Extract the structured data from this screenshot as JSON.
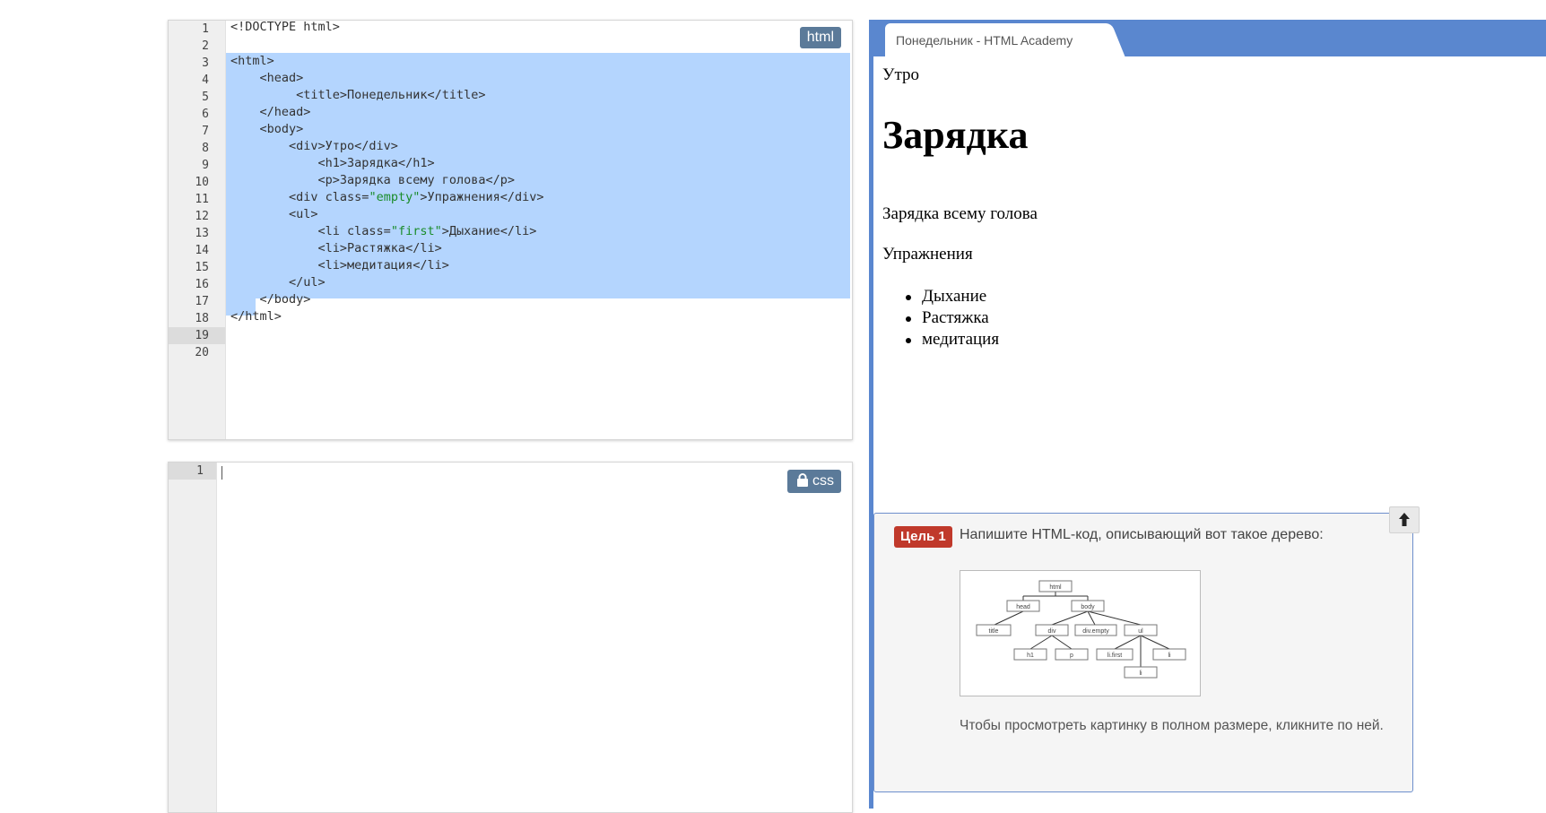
{
  "html_editor": {
    "badge": "html",
    "line_numbers": [
      "1",
      "2",
      "3",
      "4",
      "5",
      "6",
      "7",
      "8",
      "9",
      "10",
      "11",
      "12",
      "13",
      "14",
      "15",
      "16",
      "17",
      "18",
      "19",
      "20"
    ],
    "lines": [
      "<!DOCTYPE html>",
      "",
      "<html>",
      "    <head>",
      "         <title>Понедельник</title>",
      "    </head>",
      "    <body>",
      "        <div>Утро</div>",
      "            <h1>Зарядка</h1>",
      "            <p>Зарядка всему голова</p>",
      "        <div class=\"empty\">Упражнения</div>",
      "        <ul>",
      "            <li class=\"first\">Дыхание</li>",
      "            <li>Растяжка</li>",
      "            <li>медитация</li>",
      "        </ul>",
      "    </body>",
      "</html>",
      "",
      ""
    ],
    "line11": {
      "a": "        <div class=",
      "s": "\"empty\"",
      "b": ">Упражнения</div>"
    },
    "line13": {
      "a": "            <li class=",
      "s": "\"first\"",
      "b": ">Дыхание</li>"
    }
  },
  "css_editor": {
    "badge": "css",
    "badge_icon": "lock-icon",
    "line_numbers": [
      "1"
    ]
  },
  "preview": {
    "tab_title": "Понедельник - HTML Academy",
    "div_text": "Утро",
    "h1_text": "Зарядка",
    "p_text": "Зарядка всему голова",
    "empty_div_text": "Упражнения",
    "list": [
      "Дыхание",
      "Растяжка",
      "медитация"
    ]
  },
  "goal": {
    "badge": "Цель 1",
    "text": "Напишите HTML-код, описывающий вот такое дерево:",
    "tree_nodes": [
      "html",
      "head",
      "body",
      "title",
      "div",
      "div.empty",
      "ul",
      "h1",
      "p",
      "li.first",
      "li",
      "li"
    ],
    "hint": "Чтобы просмотреть картинку в полном размере, кликните по ней."
  },
  "colors": {
    "accent": "#5a87cf",
    "badge": "#5b7a99",
    "goal_badge": "#c0392b",
    "selection": "#b4d5fe",
    "string": "#1a8c2a"
  }
}
